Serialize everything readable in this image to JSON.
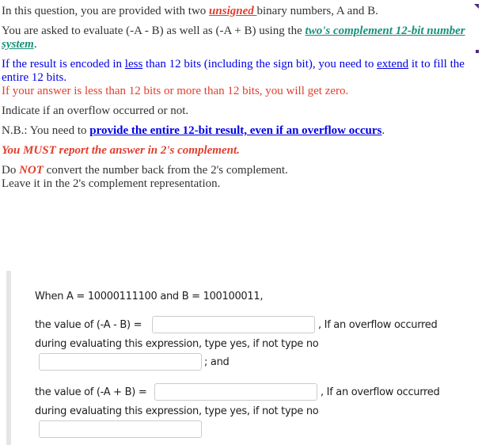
{
  "intro": {
    "p1": {
      "before": "In this question, you are provided with two ",
      "emph": "unsigned ",
      "after": "binary numbers, A and B."
    },
    "p2": {
      "before": "You are asked to evaluate (-A - B) as well as (-A + B) using the ",
      "emph": "two's complement 12-bit number system",
      "after": "."
    },
    "p3": {
      "a": "If the result is encoded in ",
      "less": "less",
      "b": " than 12 bits (including the sign bit), you need to ",
      "extend": "extend",
      "c": " it to fill the entire 12 bits."
    },
    "p4": "If your answer is less than 12 bits or more than 12 bits, you will get zero.",
    "p5": "Indicate if an overflow occurred or not.",
    "p6": {
      "before": "N.B.: You need to ",
      "emph": "provide the entire 12-bit result, even if an overflow occurs",
      "after": "."
    },
    "p7": "You MUST report the answer in 2's complement.",
    "p8": {
      "before": "Do ",
      "emph": "NOT",
      "after": " convert the number back from the 2's complement."
    },
    "p9": "Leave it in the 2's complement representation."
  },
  "question": {
    "given": "When A = 10000111100 and B = 100100011,",
    "q1_label": "the value of (-A - B) =",
    "q1_value": "",
    "overflow_suffix": ", If an overflow occurred",
    "overflow_prompt": "during evaluating this expression, type yes, if not type no",
    "q1_overflow_value": "",
    "and_label": "; and",
    "q2_label": "the value of (-A + B) =",
    "q2_value": "",
    "q2_overflow_value": ""
  },
  "colors": {
    "text": "#333333",
    "blue": "#0000e6",
    "red": "#e03e2d",
    "teal": "#169179"
  }
}
